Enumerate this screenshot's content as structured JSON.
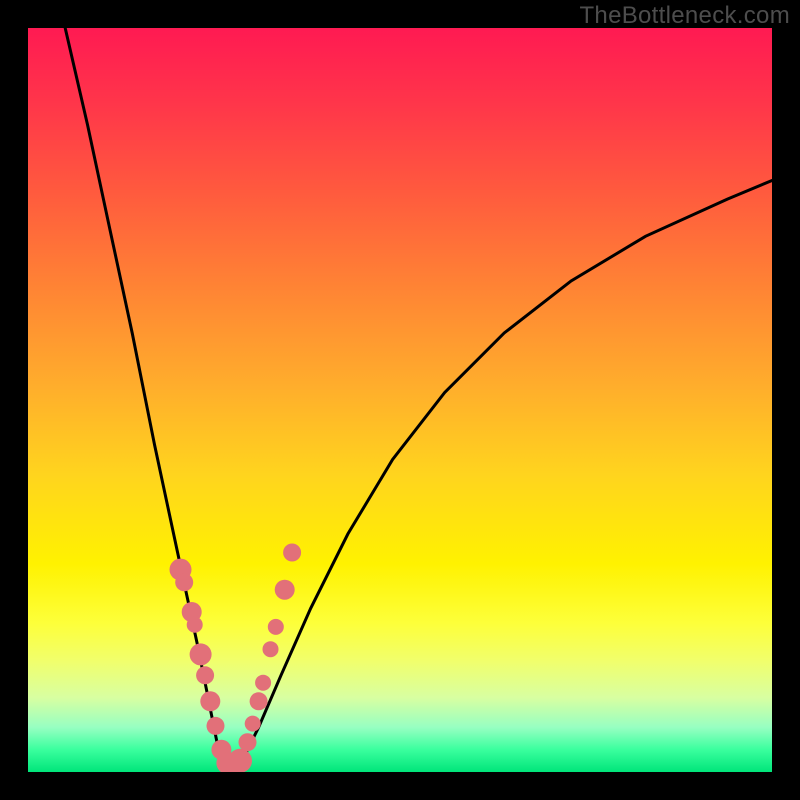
{
  "watermark": {
    "text": "TheBottleneck.com"
  },
  "chart_data": {
    "type": "line",
    "title": "",
    "xlabel": "",
    "ylabel": "",
    "xlim": [
      0,
      1
    ],
    "ylim": [
      0,
      1
    ],
    "note": "No numeric axes visible; x and y are normalized 0–1 over plot area. Curve is a V-shaped bottleneck profile; y≈1 is top (red), y≈0 is bottom (green). Pink dots mark data points clustered near the trough.",
    "series": [
      {
        "name": "bottleneck-curve-left",
        "x": [
          0.05,
          0.08,
          0.11,
          0.14,
          0.17,
          0.2,
          0.215,
          0.228,
          0.24,
          0.25,
          0.256,
          0.262,
          0.268,
          0.27
        ],
        "y": [
          1.0,
          0.87,
          0.73,
          0.59,
          0.44,
          0.3,
          0.23,
          0.17,
          0.11,
          0.06,
          0.03,
          0.015,
          0.008,
          0.007
        ]
      },
      {
        "name": "bottleneck-curve-right",
        "x": [
          0.27,
          0.29,
          0.31,
          0.34,
          0.38,
          0.43,
          0.49,
          0.56,
          0.64,
          0.73,
          0.83,
          0.94,
          1.0
        ],
        "y": [
          0.007,
          0.02,
          0.06,
          0.13,
          0.22,
          0.32,
          0.42,
          0.51,
          0.59,
          0.66,
          0.72,
          0.77,
          0.795
        ]
      },
      {
        "name": "data-points",
        "x": [
          0.205,
          0.21,
          0.22,
          0.224,
          0.232,
          0.238,
          0.245,
          0.252,
          0.26,
          0.268,
          0.275,
          0.285,
          0.295,
          0.302,
          0.31,
          0.316,
          0.326,
          0.333,
          0.345,
          0.355
        ],
        "y": [
          0.272,
          0.255,
          0.215,
          0.198,
          0.158,
          0.13,
          0.095,
          0.062,
          0.03,
          0.012,
          0.01,
          0.015,
          0.04,
          0.065,
          0.095,
          0.12,
          0.165,
          0.195,
          0.245,
          0.295
        ],
        "r": [
          11,
          9,
          10,
          8,
          11,
          9,
          10,
          9,
          10,
          11,
          12,
          12,
          9,
          8,
          9,
          8,
          8,
          8,
          10,
          9
        ]
      }
    ],
    "background_gradient": {
      "stops": [
        {
          "pos": 0.0,
          "color": "#ff1a52"
        },
        {
          "pos": 0.35,
          "color": "#ff8434"
        },
        {
          "pos": 0.7,
          "color": "#fff200"
        },
        {
          "pos": 0.97,
          "color": "#3aff9e"
        },
        {
          "pos": 1.0,
          "color": "#00e57a"
        }
      ]
    }
  }
}
